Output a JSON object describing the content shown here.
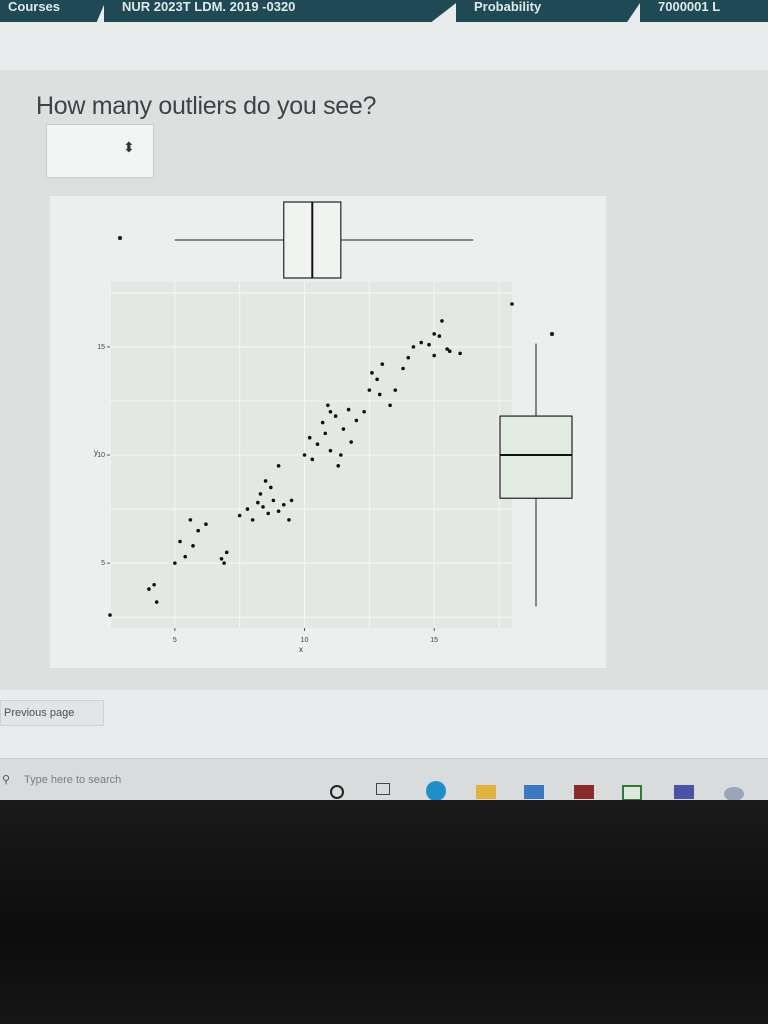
{
  "nav": {
    "tabs": [
      "Courses",
      "NUR 2023T LDM. 2019 -0320",
      "Probability",
      "7000001 L"
    ]
  },
  "question": {
    "text": "How many outliers do you see?"
  },
  "answer_select": {
    "value": "",
    "arrow_glyph": "⬍"
  },
  "buttons": {
    "previous_page": "Previous page"
  },
  "taskbar": {
    "search_placeholder": "Type here to search",
    "search_icon": "magnifier-icon",
    "icons": [
      "cortana-icon",
      "task-view-icon",
      "edge-icon",
      "file-explorer-icon",
      "mail-icon",
      "store-icon",
      "xbox-icon",
      "teams-icon",
      "r-icon"
    ]
  },
  "chart_data": {
    "type": "scatter",
    "title": "",
    "xlabel": "x",
    "ylabel": "y",
    "xlim": [
      2.5,
      18
    ],
    "ylim": [
      2,
      18
    ],
    "x_ticks": [
      5,
      10,
      15
    ],
    "y_ticks": [
      5,
      10,
      15
    ],
    "grid": true,
    "points": [
      [
        2.5,
        2.6
      ],
      [
        4.0,
        3.8
      ],
      [
        4.3,
        3.2
      ],
      [
        4.2,
        4.0
      ],
      [
        5.0,
        5.0
      ],
      [
        5.4,
        5.3
      ],
      [
        5.7,
        5.8
      ],
      [
        5.2,
        6.0
      ],
      [
        5.9,
        6.5
      ],
      [
        6.2,
        6.8
      ],
      [
        5.6,
        7.0
      ],
      [
        6.8,
        5.2
      ],
      [
        7.0,
        5.5
      ],
      [
        6.9,
        5.0
      ],
      [
        7.5,
        7.2
      ],
      [
        7.8,
        7.5
      ],
      [
        8.0,
        7.0
      ],
      [
        8.2,
        7.8
      ],
      [
        8.4,
        7.6
      ],
      [
        8.6,
        7.3
      ],
      [
        8.8,
        7.9
      ],
      [
        8.3,
        8.2
      ],
      [
        8.7,
        8.5
      ],
      [
        9.0,
        7.4
      ],
      [
        8.5,
        8.8
      ],
      [
        9.2,
        7.7
      ],
      [
        9.5,
        7.9
      ],
      [
        9.4,
        7.0
      ],
      [
        9.0,
        9.5
      ],
      [
        10.0,
        10.0
      ],
      [
        10.2,
        10.8
      ],
      [
        10.5,
        10.5
      ],
      [
        10.8,
        11.0
      ],
      [
        11.0,
        10.2
      ],
      [
        10.3,
        9.8
      ],
      [
        10.7,
        11.5
      ],
      [
        11.2,
        11.8
      ],
      [
        11.5,
        11.2
      ],
      [
        11.8,
        10.6
      ],
      [
        11.0,
        12.0
      ],
      [
        10.9,
        12.3
      ],
      [
        11.4,
        10.0
      ],
      [
        11.7,
        12.1
      ],
      [
        12.0,
        11.6
      ],
      [
        12.3,
        12.0
      ],
      [
        11.3,
        9.5
      ],
      [
        12.5,
        13.0
      ],
      [
        12.8,
        13.5
      ],
      [
        12.6,
        13.8
      ],
      [
        13.3,
        12.3
      ],
      [
        13.0,
        14.2
      ],
      [
        12.9,
        12.8
      ],
      [
        13.5,
        13.0
      ],
      [
        13.8,
        14.0
      ],
      [
        14.2,
        15.0
      ],
      [
        14.5,
        15.2
      ],
      [
        14.0,
        14.5
      ],
      [
        15.0,
        14.6
      ],
      [
        15.2,
        15.5
      ],
      [
        15.6,
        14.8
      ],
      [
        15.0,
        15.6
      ],
      [
        14.8,
        15.1
      ],
      [
        15.5,
        14.9
      ],
      [
        16.0,
        14.7
      ],
      [
        15.3,
        16.2
      ]
    ],
    "top_boxplot": {
      "variable": "x",
      "whisker_low": 5.0,
      "q1": 9.2,
      "median": 10.3,
      "q3": 11.4,
      "whisker_high": 16.5,
      "outliers": [
        2.5
      ]
    },
    "right_boxplot": {
      "variable": "y",
      "whisker_low": 3.0,
      "q1": 8.0,
      "median": 10.0,
      "q3": 11.8,
      "whisker_high": 17.0,
      "outliers": [
        18.0
      ]
    },
    "extra_points": [
      [
        18.0,
        19.0
      ]
    ]
  }
}
